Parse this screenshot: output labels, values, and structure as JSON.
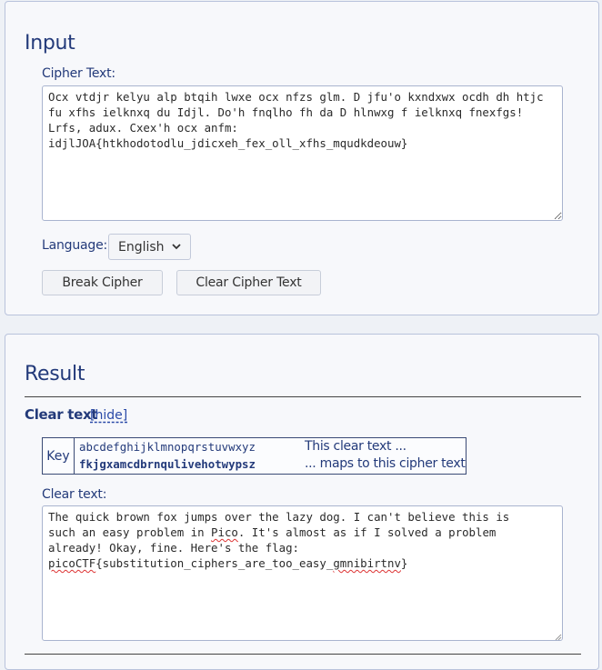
{
  "input": {
    "title": "Input",
    "cipher_label": "Cipher Text:",
    "cipher_text": "Ocx vtdjr kelyu alp btqih lwxe ocx nfzs glm. D jfu'o kxndxwx ocdh dh htjc fu xfhs ielknxq du Idjl. Do'h fnqlho fh da D hlnwxg f ielknxq fnexfgs! Lrfs, adux. Cxex'h ocx anfm:\nidjlJOA{htkhodotodlu_jdicxeh_fex_oll_xfhs_mqudkdeouw}",
    "language_label": "Language:",
    "language_value": "English",
    "break_button": "Break Cipher",
    "clear_button": "Clear Cipher Text"
  },
  "result": {
    "title": "Result",
    "clear_text_heading": "Clear text",
    "hide_link": "[hide]",
    "key_label": "Key",
    "key_plain": "abcdefghijklmnopqrstuvwxyz",
    "key_cipher": "fkjgxamcdbrnqulivehotwypsz",
    "key_plain_desc": "This clear text ...",
    "key_cipher_desc": "... maps to this cipher text",
    "clear_label": "Clear text:",
    "clear_text": {
      "l1": "The quick brown fox jumps over the lazy dog. I can't believe this is",
      "l2a": "such an easy problem in ",
      "l2b": "Pico",
      "l2c": ". It's almost as if I solved a problem",
      "l3": "already! Okay, fine. Here's the flag:",
      "l4a": "picoCTF",
      "l4b": "{substitution_ciphers_are_too_easy_",
      "l4c": "gmnibirtnv",
      "l4d": "}"
    }
  }
}
